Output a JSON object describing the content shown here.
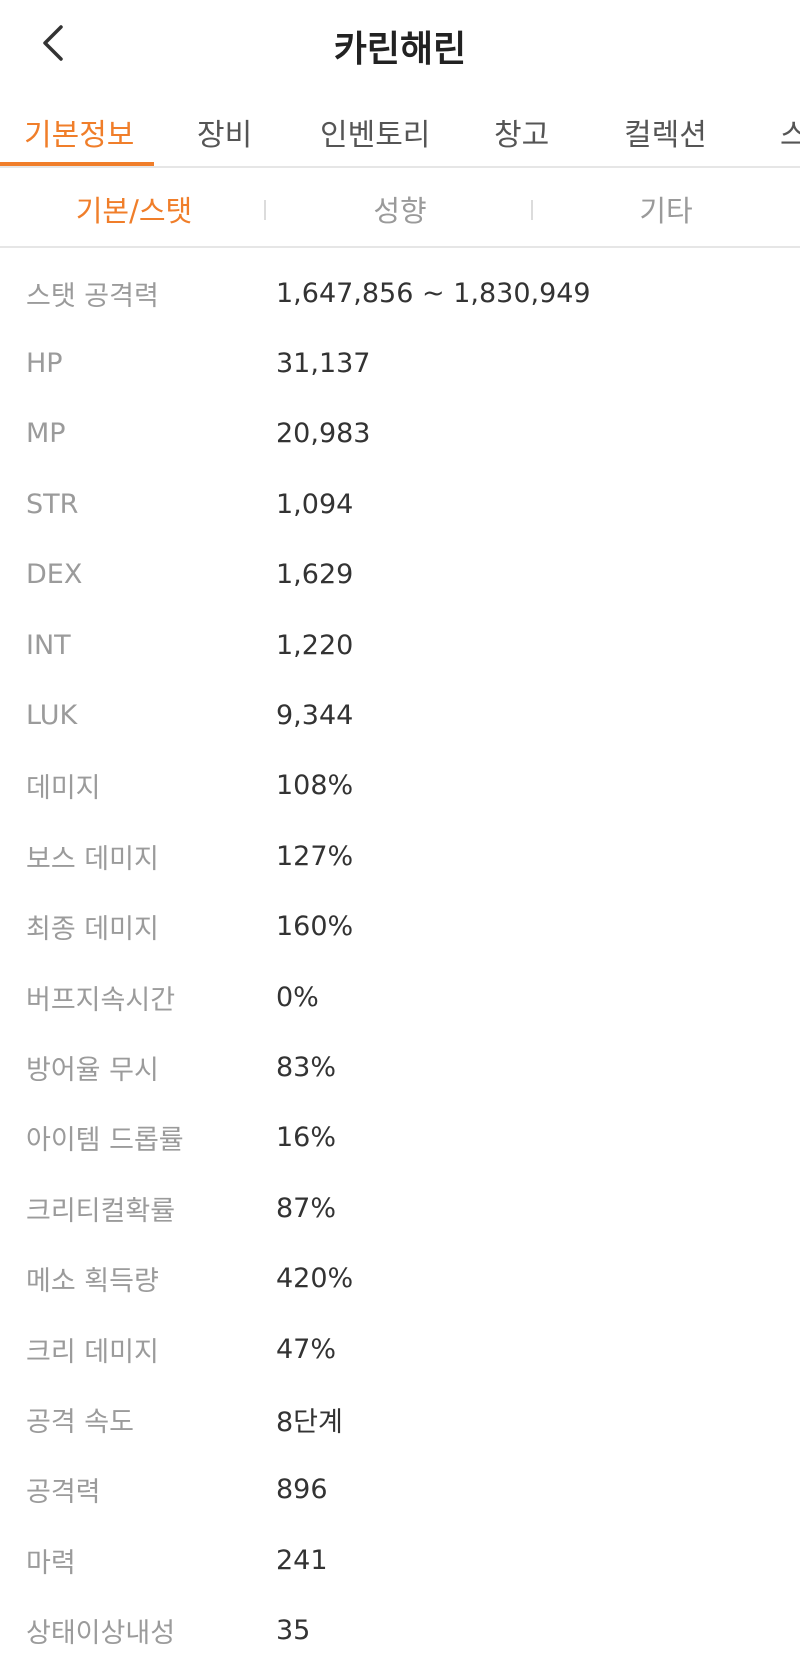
{
  "header": {
    "title": "카린해린",
    "back_icon": "chevron-left-icon"
  },
  "main_tabs": [
    {
      "label": "기본정보",
      "active": true
    },
    {
      "label": "장비",
      "active": false
    },
    {
      "label": "인벤토리",
      "active": false
    },
    {
      "label": "창고",
      "active": false
    },
    {
      "label": "컬렉션",
      "active": false
    },
    {
      "label": "스",
      "active": false
    }
  ],
  "sub_tabs": [
    {
      "label": "기본/스탯",
      "active": true
    },
    {
      "label": "성향",
      "active": false
    },
    {
      "label": "기타",
      "active": false
    }
  ],
  "stats": [
    {
      "label": "스탯 공격력",
      "value": "1,647,856 ~ 1,830,949"
    },
    {
      "label": "HP",
      "value": "31,137"
    },
    {
      "label": "MP",
      "value": "20,983"
    },
    {
      "label": "STR",
      "value": "1,094"
    },
    {
      "label": "DEX",
      "value": "1,629"
    },
    {
      "label": "INT",
      "value": "1,220"
    },
    {
      "label": "LUK",
      "value": "9,344"
    },
    {
      "label": "데미지",
      "value": "108%"
    },
    {
      "label": "보스 데미지",
      "value": "127%"
    },
    {
      "label": "최종 데미지",
      "value": "160%"
    },
    {
      "label": "버프지속시간",
      "value": "0%"
    },
    {
      "label": "방어율 무시",
      "value": "83%"
    },
    {
      "label": "아이템 드롭률",
      "value": "16%"
    },
    {
      "label": "크리티컬확률",
      "value": "87%"
    },
    {
      "label": "메소 획득량",
      "value": "420%"
    },
    {
      "label": "크리 데미지",
      "value": "47%"
    },
    {
      "label": "공격 속도",
      "value": "8단계"
    },
    {
      "label": "공격력",
      "value": "896"
    },
    {
      "label": "마력",
      "value": "241"
    },
    {
      "label": "상태이상내성",
      "value": "35"
    }
  ],
  "colors": {
    "accent": "#f07e2a",
    "label": "#9b9b9b",
    "value": "#333333"
  }
}
